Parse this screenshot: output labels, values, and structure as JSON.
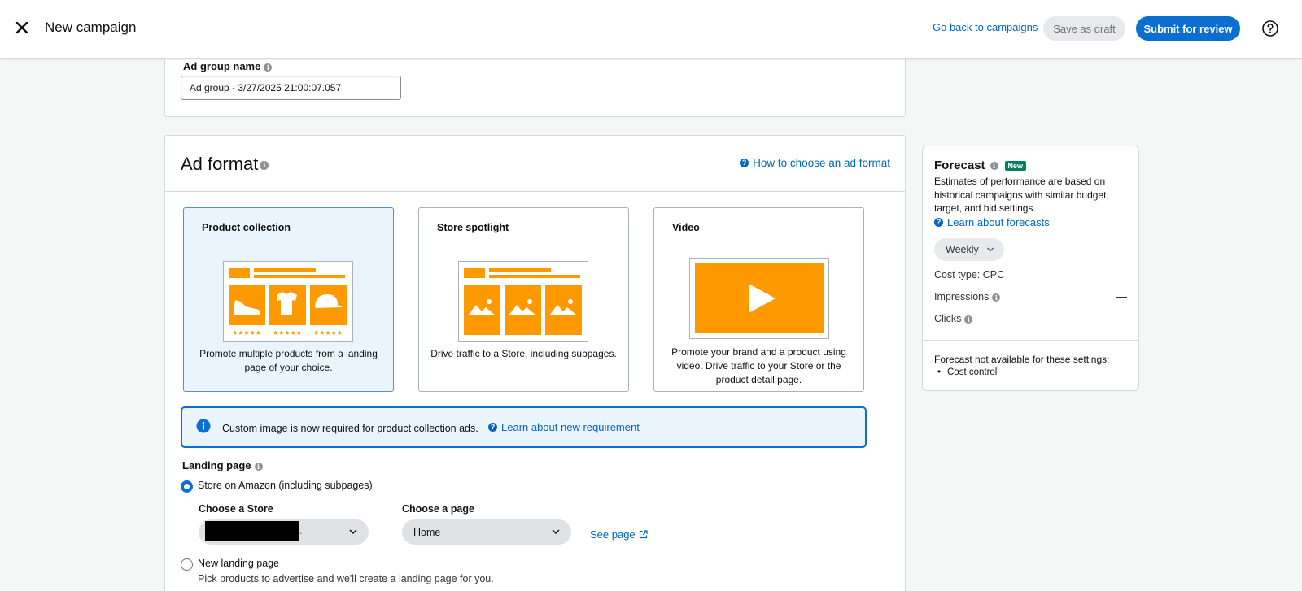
{
  "header": {
    "title": "New campaign",
    "back_link": "Go back to campaigns",
    "save_draft_label": "Save as draft",
    "submit_label": "Submit for review"
  },
  "ad_group": {
    "label": "Ad group name",
    "value": "Ad group - 3/27/2025 21:00:07.057"
  },
  "ad_format": {
    "title": "Ad format",
    "help_link": "How to choose an ad format",
    "tiles": [
      {
        "title": "Product collection",
        "description": "Promote multiple products from a landing page of your choice.",
        "selected": true
      },
      {
        "title": "Store spotlight",
        "description": "Drive traffic to a Store, including subpages.",
        "selected": false
      },
      {
        "title": "Video",
        "description": "Promote your brand and a product using video. Drive traffic to your Store or the product detail page.",
        "selected": false
      }
    ],
    "notice": {
      "text": "Custom image is now required for product collection ads.",
      "link": "Learn about new requirement"
    }
  },
  "landing_page": {
    "label": "Landing page",
    "option_store": "Store on Amazon (including subpages)",
    "choose_store_label": "Choose a Store",
    "store_tail": ".",
    "choose_page_label": "Choose a page",
    "page_value": "Home",
    "see_page": "See page",
    "option_new": "New landing page",
    "option_new_desc": "Pick products to advertise and we'll create a landing page for you."
  },
  "forecast": {
    "title": "Forecast",
    "badge": "New",
    "description": "Estimates of performance are based on historical campaigns with similar budget, target, and bid settings.",
    "learn_link": "Learn about forecasts",
    "period": "Weekly",
    "cost_type": "Cost type: CPC",
    "impressions_label": "Impressions",
    "impressions_value": "—",
    "clicks_label": "Clicks",
    "clicks_value": "—",
    "not_available": "Forecast not available for these settings:",
    "not_available_items": [
      "Cost control"
    ]
  },
  "colors": {
    "accent": "#0a6fd1",
    "link": "#0066c0",
    "tile_orange": "#ff9900",
    "selected_bg": "#eaf4fd",
    "badge_green": "#067d62"
  }
}
